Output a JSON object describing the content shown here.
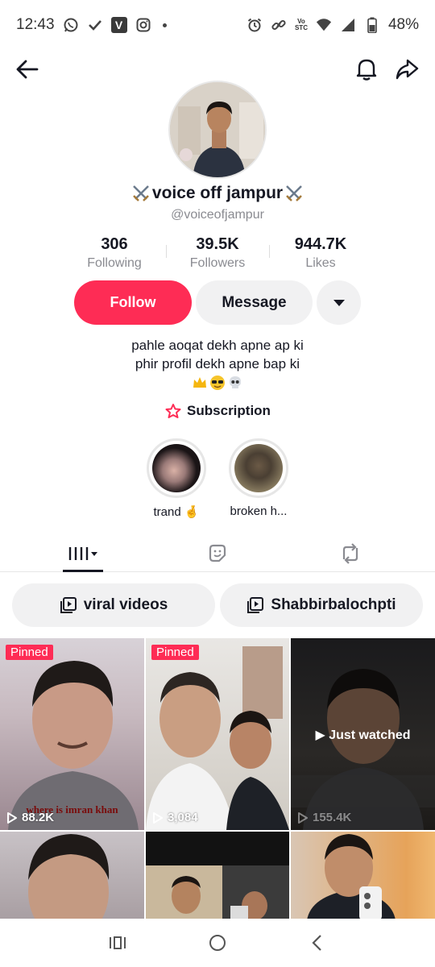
{
  "status_bar": {
    "time": "12:43",
    "battery": "48%",
    "volte_line1": "Vo",
    "volte_line2": "STC",
    "left_icons": [
      "whatsapp-icon",
      "check-icon",
      "v-app-icon",
      "instagram-icon",
      "dot-icon"
    ],
    "right_icons": [
      "alarm-icon",
      "link-icon",
      "volte-icon",
      "wifi-icon",
      "signal-icon",
      "battery-icon"
    ]
  },
  "top_nav": {
    "icons": [
      "back-arrow-icon",
      "bell-icon",
      "share-icon"
    ]
  },
  "profile": {
    "display_name": "voice off jampur",
    "name_decoration": "crossed-swords-icon",
    "username": "@voiceofjampur",
    "stats": [
      {
        "value": "306",
        "label": "Following"
      },
      {
        "value": "39.5K",
        "label": "Followers"
      },
      {
        "value": "944.7K",
        "label": "Likes"
      }
    ],
    "follow_label": "Follow",
    "message_label": "Message",
    "bio_lines": [
      "pahle aoqat dekh apne ap ki",
      "phir profil dekh apne bap ki"
    ],
    "bio_emojis": [
      "crown-emoji",
      "sunglasses-emoji",
      "skull-emoji"
    ],
    "subscription_label": "Subscription"
  },
  "highlights": [
    {
      "label": "trand 🤞"
    },
    {
      "label": "broken h..."
    }
  ],
  "tabs": [
    "videos-grid-icon",
    "liked-icon",
    "reposts-icon"
  ],
  "playlists": [
    {
      "label": "viral videos"
    },
    {
      "label": "Shabbirbalochpti"
    }
  ],
  "videos": [
    {
      "pinned": "Pinned",
      "views": "88.2K",
      "caption": "where is imran khan"
    },
    {
      "pinned": "Pinned",
      "views": "3,084"
    },
    {
      "overlay": "Just watched",
      "views": "155.4K"
    },
    {},
    {},
    {}
  ],
  "colors": {
    "accent": "#fe2c55",
    "text": "#161823",
    "muted": "#8a8b91",
    "chip_bg": "#f1f1f2"
  },
  "nav_bar": {
    "icons": [
      "recents-icon",
      "home-icon",
      "back-icon"
    ]
  }
}
